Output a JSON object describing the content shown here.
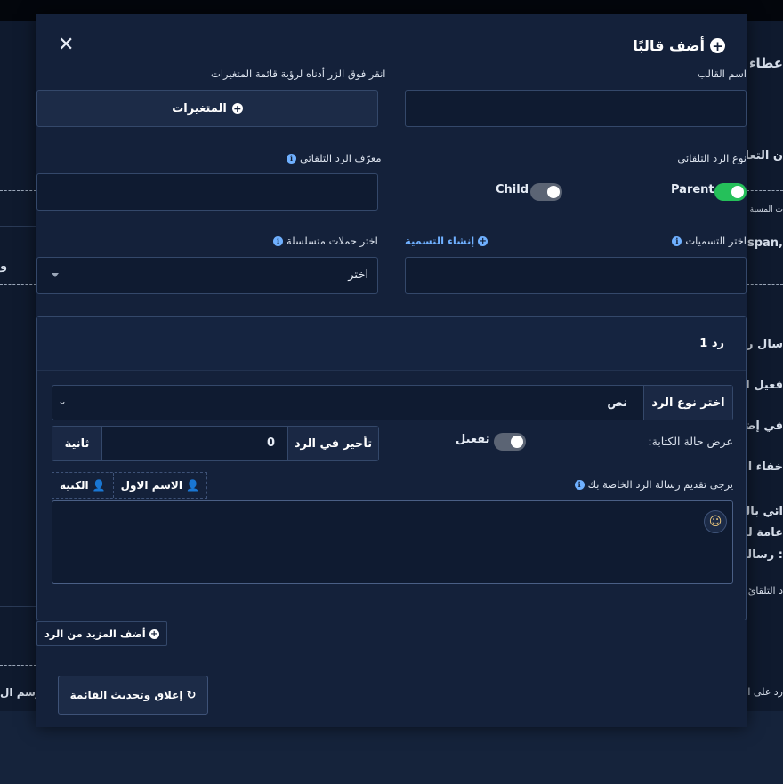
{
  "background": {
    "right_texts": [
      "عطاء ا",
      "ن التعا",
      "ت المسية",
      "span,",
      "سال رس",
      "فعيل ال",
      "في إضا",
      "خفاء الت",
      "ائي بالذ",
      "عامة لل",
      "رسالة :",
      "د التلقائ",
      "رد على ال"
    ],
    "left_texts": [
      "و",
      "وسم ال"
    ]
  },
  "modal": {
    "title": "أضف قالبًا",
    "close_symbol": "✕",
    "template_name_label": "اسم القالب",
    "variables_hint": "انقر فوق الزر أدناه لرؤية قائمة المتغيرات",
    "variables_button": "المتغيرات",
    "reply_type_label": "نوع الرد التلقائي",
    "reply_id_label": "معرّف الرد التلقائي",
    "parent_label": "Parent",
    "child_label": "Child",
    "labels_select_label": "اختر التسميات",
    "create_label_link": "إنشاء التسمية",
    "sequence_label": "اختر حملات متسلسلة",
    "sequence_value": "اختر",
    "reply_card": {
      "title": "رد 1",
      "type_label": "اختر نوع الرد",
      "type_value": "نص",
      "typing_label": "عرض حالة الكتابة:",
      "typing_toggle_label": "تفعيل",
      "delay_label": "تأخير في الرد",
      "delay_value": "0",
      "delay_unit": "ثانية",
      "message_prompt": "يرجى تقديم رسالة الرد الخاصة بك",
      "tag_first_name": "الاسم الاول",
      "tag_last_name": "الكنية"
    },
    "add_more_button": "أضف المزيد من الرد",
    "close_refresh_button": "إغلاق وتحديث القائمة"
  }
}
